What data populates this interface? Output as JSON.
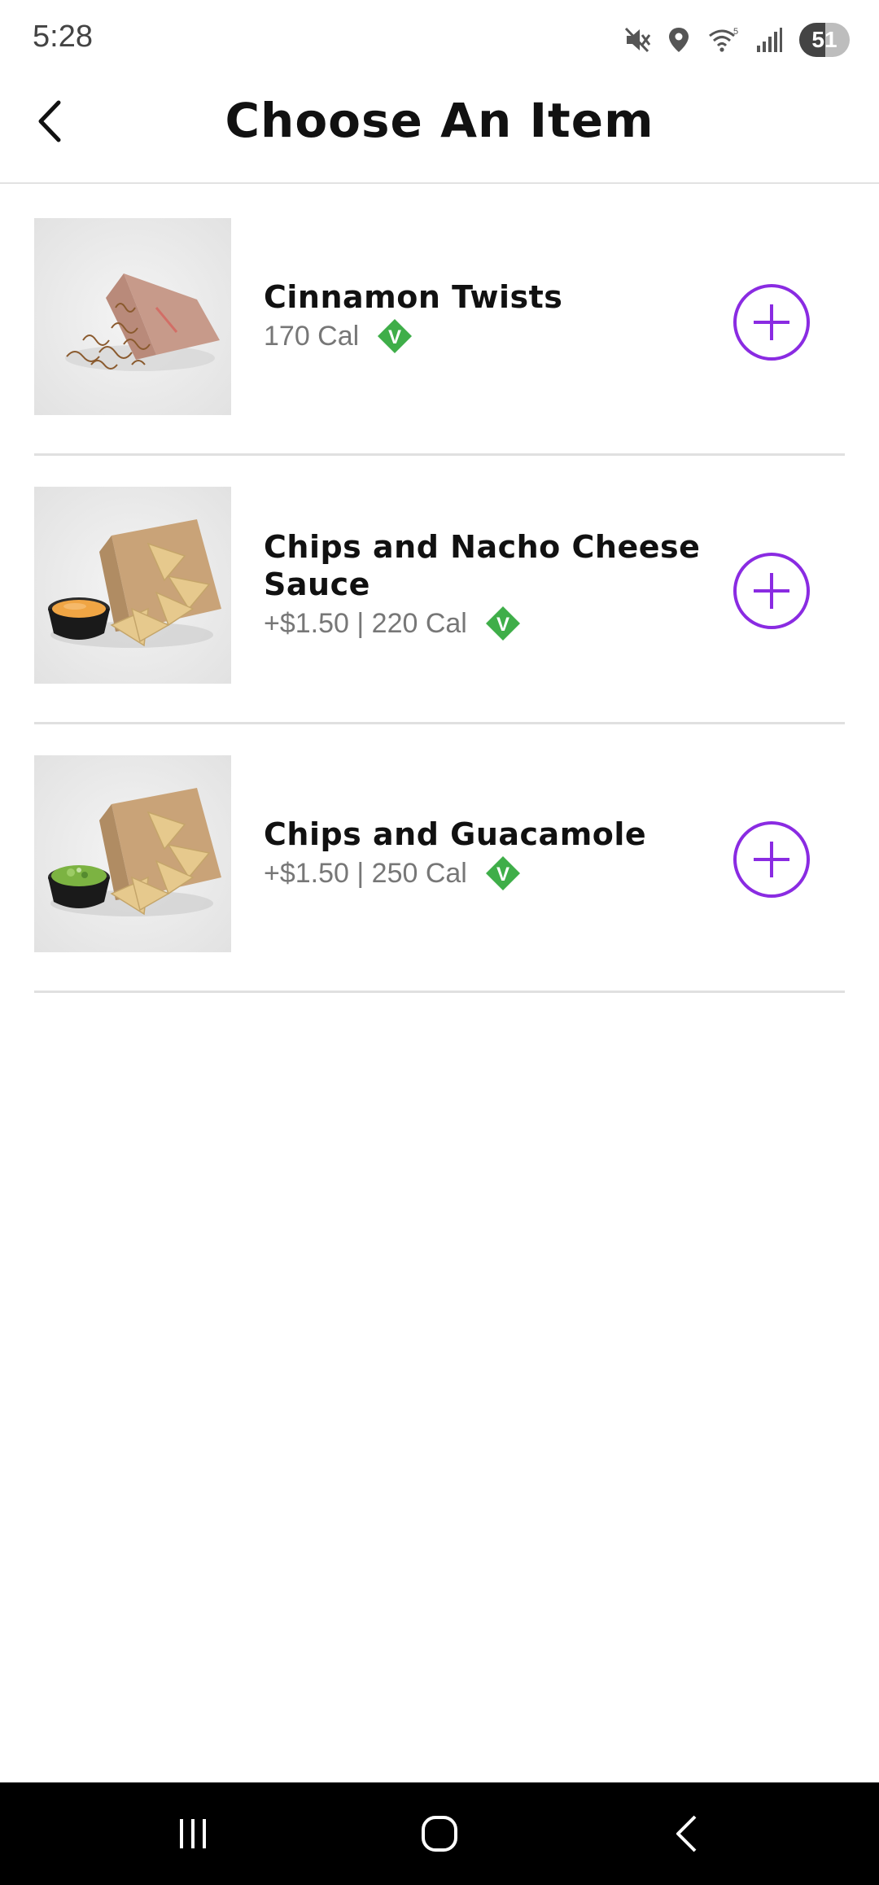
{
  "status_bar": {
    "time": "5:28",
    "battery": "51",
    "battery_level": 0.51
  },
  "header": {
    "title": "Choose An Item",
    "back_icon": "chevron-left-icon"
  },
  "items": [
    {
      "name": "Cinnamon Twists",
      "meta": "170 Cal",
      "badge": "V",
      "image": "cinnamon-twists"
    },
    {
      "name": "Chips and Nacho Cheese Sauce",
      "meta": "+$1.50 | 220 Cal",
      "badge": "V",
      "image": "chips-nacho-cheese"
    },
    {
      "name": "Chips and Guacamole",
      "meta": "+$1.50 | 250 Cal",
      "badge": "V",
      "image": "chips-guacamole"
    }
  ],
  "colors": {
    "accent": "#8a2be2",
    "veg_green": "#3fae49",
    "nav_bar": "#000000"
  },
  "nav_bar": {
    "recent_icon": "recent-apps-icon",
    "home_icon": "home-icon",
    "back_icon": "back-icon"
  }
}
